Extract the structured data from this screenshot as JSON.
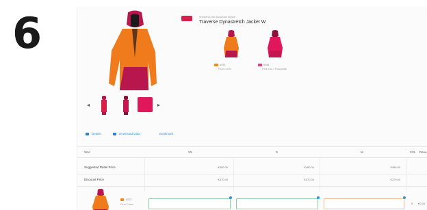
{
  "step_number": "6",
  "colors": {
    "accent": "#2d9ad6",
    "brand_badge": "#d81f4a",
    "jacket_orange": "#f07b1c",
    "jacket_magenta": "#b8174e"
  },
  "badge": {
    "label": "NEW"
  },
  "product": {
    "eyebrow": "Women's Ski-Mountain Alpine",
    "title": "Traverse Dynastretch Jacket W"
  },
  "variants": [
    {
      "code": "4571",
      "name": "Fluo Coral",
      "swatch": "#f08a1c"
    },
    {
      "code": "6081",
      "name": "Pink Glo / Turquoise",
      "swatch": "#e23a7a"
    }
  ],
  "tabs": [
    {
      "label": "Details",
      "icon": "list-icon"
    },
    {
      "label": "Download Data",
      "icon": "download-icon"
    },
    {
      "label": "Bookmark",
      "icon": ""
    }
  ],
  "table": {
    "size_header": "Size",
    "sizes": [
      "XS",
      "S",
      "M",
      "XXL"
    ],
    "trailing_header": "Resu",
    "rows": [
      {
        "label": "Suggested Retail Price",
        "values": [
          "€480.00",
          "€480.00",
          "€480.00"
        ]
      },
      {
        "label": "Discount Price",
        "values": [
          "€370.00",
          "€370.00",
          "€370.00"
        ]
      }
    ]
  },
  "order_row": {
    "code": "4571",
    "name": "Fluo Coral",
    "trailing_values": [
      "0",
      "€0.00"
    ]
  }
}
